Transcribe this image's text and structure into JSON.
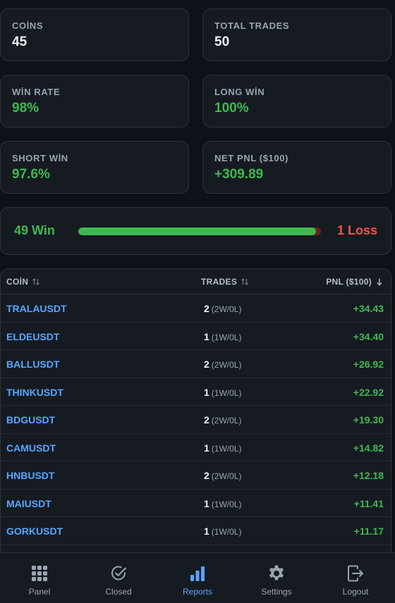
{
  "stats": [
    {
      "label": "COİNS",
      "value": "45",
      "tone": "white"
    },
    {
      "label": "TOTAL TRADES",
      "value": "50",
      "tone": "white"
    },
    {
      "label": "WİN RATE",
      "value": "98%",
      "tone": "green"
    },
    {
      "label": "LONG WİN",
      "value": "100%",
      "tone": "green"
    },
    {
      "label": "SHORT WİN",
      "value": "97.6%",
      "tone": "green"
    },
    {
      "label": "NET PNL ($100)",
      "value": "+309.89",
      "tone": "green"
    }
  ],
  "winloss": {
    "win_label": "49 Win",
    "loss_label": "1 Loss",
    "win_fraction": 0.98
  },
  "table": {
    "headers": {
      "coin": "COİN",
      "trades": "TRADES",
      "pnl": "PNL ($100)"
    },
    "rows": [
      {
        "coin": "TRALAUSDT",
        "trades": "2",
        "wl": "(2W/0L)",
        "pnl": "+34.43"
      },
      {
        "coin": "ELDEUSDT",
        "trades": "1",
        "wl": "(1W/0L)",
        "pnl": "+34.40"
      },
      {
        "coin": "BALLUSDT",
        "trades": "2",
        "wl": "(2W/0L)",
        "pnl": "+26.92"
      },
      {
        "coin": "THINKUSDT",
        "trades": "1",
        "wl": "(1W/0L)",
        "pnl": "+22.92"
      },
      {
        "coin": "BDGUSDT",
        "trades": "2",
        "wl": "(2W/0L)",
        "pnl": "+19.30"
      },
      {
        "coin": "CAMUSDT",
        "trades": "1",
        "wl": "(1W/0L)",
        "pnl": "+14.82"
      },
      {
        "coin": "HNBUSDT",
        "trades": "2",
        "wl": "(2W/0L)",
        "pnl": "+12.18"
      },
      {
        "coin": "MAIUSDT",
        "trades": "1",
        "wl": "(1W/0L)",
        "pnl": "+11.41"
      },
      {
        "coin": "GORKUSDT",
        "trades": "1",
        "wl": "(1W/0L)",
        "pnl": "+11.17"
      }
    ]
  },
  "nav": {
    "panel": "Panel",
    "closed": "Closed",
    "reports": "Reports",
    "settings": "Settings",
    "logout": "Logout",
    "active": "reports"
  },
  "colors": {
    "background": "#0e1117",
    "card": "#161b22",
    "green": "#3fb950",
    "red": "#f85149",
    "link": "#58a6ff"
  }
}
